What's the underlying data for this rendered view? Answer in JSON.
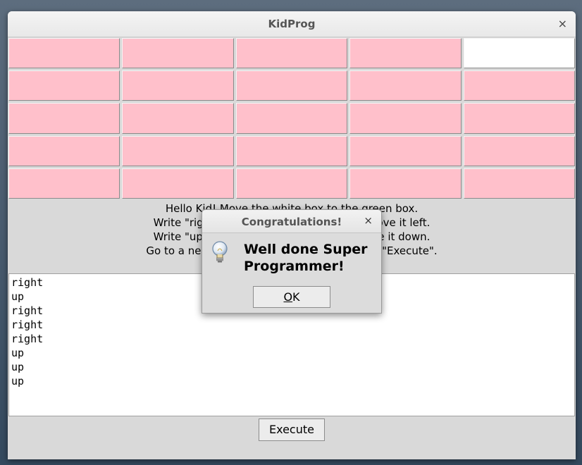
{
  "window": {
    "title": "KidProg",
    "close_glyph": "×"
  },
  "grid": {
    "rows": 5,
    "cols": 5,
    "cell_color": "#ffc0cb",
    "highlight_color": "#ffffff",
    "white_cell": {
      "row": 0,
      "col": 4
    }
  },
  "instructions": [
    "Hello Kid! Move the white box to the green box.",
    "Write \"right\" to move it right or \"left\" to move it left.",
    "Write \"up\" to move it up or \"down\" to move it down.",
    "Go to a new line for each move and click on \"Execute\"."
  ],
  "code_lines": [
    "right",
    "up",
    "right",
    "right",
    "right",
    "up",
    "up",
    "up"
  ],
  "execute_label": "Execute",
  "dialog": {
    "title": "Congratulations!",
    "close_glyph": "×",
    "icon": "lightbulb-icon",
    "message_line1": "Well done Super",
    "message_line2": "Programmer!",
    "ok_mnemonic": "O",
    "ok_rest": "K"
  }
}
